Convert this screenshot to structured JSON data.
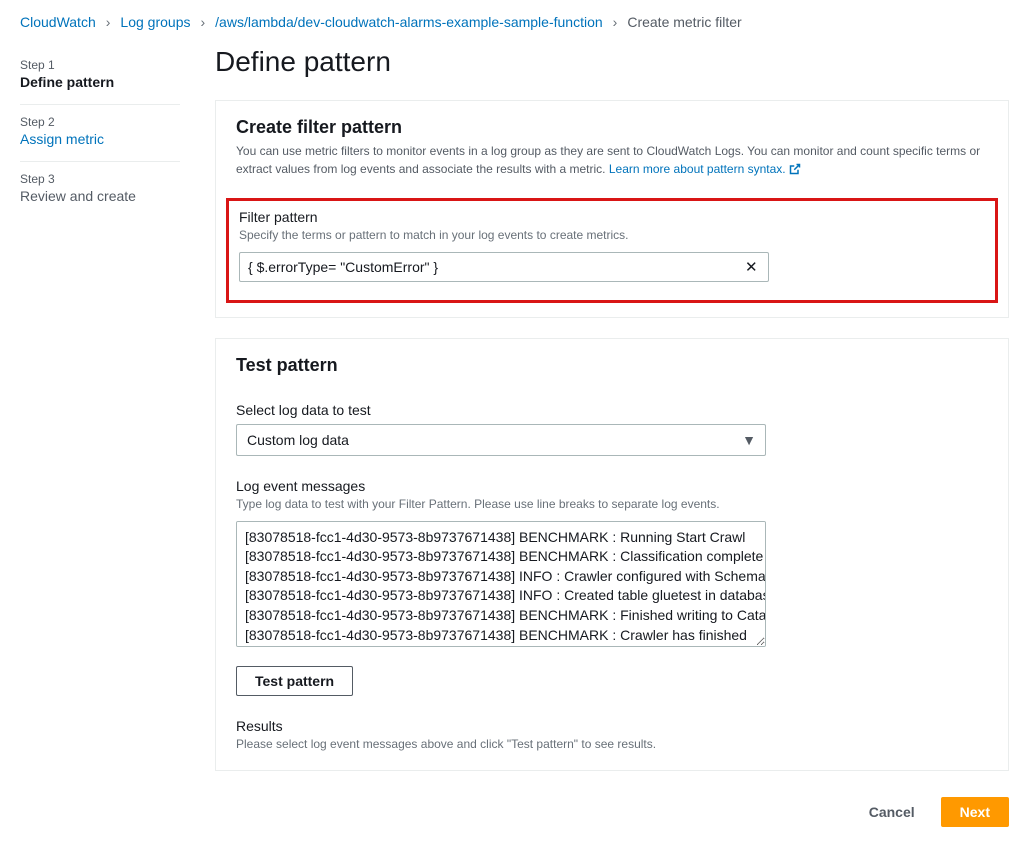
{
  "breadcrumb": {
    "items": [
      "CloudWatch",
      "Log groups",
      "/aws/lambda/dev-cloudwatch-alarms-example-sample-function"
    ],
    "current": "Create metric filter"
  },
  "sidebar": {
    "steps": [
      {
        "num": "Step 1",
        "label": "Define pattern"
      },
      {
        "num": "Step 2",
        "label": "Assign metric"
      },
      {
        "num": "Step 3",
        "label": "Review and create"
      }
    ]
  },
  "page": {
    "title": "Define pattern"
  },
  "filter_panel": {
    "title": "Create filter pattern",
    "subtitle_before": "You can use metric filters to monitor events in a log group as they are sent to CloudWatch Logs. You can monitor and count specific terms or extract values from log events and associate the results with a metric. ",
    "link_text": "Learn more about pattern syntax.",
    "field_label": "Filter pattern",
    "field_sub": "Specify the terms or pattern to match in your log events to create metrics.",
    "value": "{ $.errorType= \"CustomError\" }"
  },
  "test_panel": {
    "title": "Test pattern",
    "select_label": "Select log data to test",
    "select_value": "Custom log data",
    "textarea_label": "Log event messages",
    "textarea_sub": "Type log data to test with your Filter Pattern. Please use line breaks to separate log events.",
    "textarea_value": "[83078518-fcc1-4d30-9573-8b9737671438] BENCHMARK : Running Start Crawl\n[83078518-fcc1-4d30-9573-8b9737671438] BENCHMARK : Classification complete\n[83078518-fcc1-4d30-9573-8b9737671438] INFO : Crawler configured with Schema\n[83078518-fcc1-4d30-9573-8b9737671438] INFO : Created table gluetest in database\n[83078518-fcc1-4d30-9573-8b9737671438] BENCHMARK : Finished writing to Catalog\n[83078518-fcc1-4d30-9573-8b9737671438] BENCHMARK : Crawler has finished",
    "test_btn": "Test pattern",
    "results_label": "Results",
    "results_sub": "Please select log event messages above and click \"Test pattern\" to see results."
  },
  "footer": {
    "cancel": "Cancel",
    "next": "Next"
  }
}
